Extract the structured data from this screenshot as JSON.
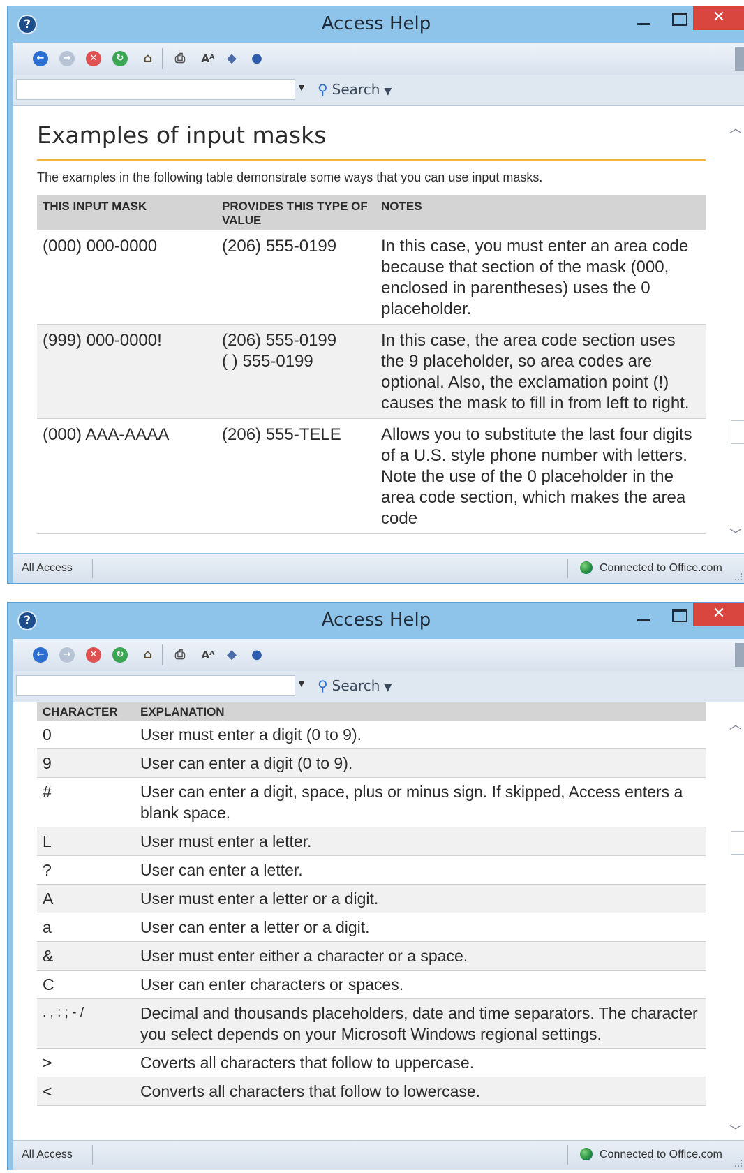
{
  "window": {
    "title": "Access Help",
    "close_glyph": "✕",
    "help_glyph": "?"
  },
  "toolbar": {
    "icons": [
      "back-icon",
      "forward-icon",
      "stop-icon",
      "refresh-icon",
      "home-icon",
      "print-icon",
      "font-size-icon",
      "toc-icon",
      "pin-icon"
    ]
  },
  "search": {
    "value": "",
    "button_label": "Search"
  },
  "status": {
    "left": "All Access",
    "right": "Connected to Office.com"
  },
  "page1": {
    "title": "Examples of input masks",
    "intro": "The examples in the following table demonstrate some ways that you can use input masks.",
    "headers": [
      "THIS INPUT MASK",
      "PROVIDES THIS TYPE OF VALUE",
      "NOTES"
    ],
    "rows": [
      {
        "mask": "(000) 000-0000",
        "value": "(206) 555-0199",
        "notes": "In this case, you must enter an area code because that section of the mask (000, enclosed in parentheses) uses the 0 placeholder."
      },
      {
        "mask": "(999) 000-0000!",
        "value": "(206) 555-0199\n( ) 555-0199",
        "notes": "In this case, the area code section uses the 9 placeholder, so area codes are optional. Also, the exclamation point (!) causes the mask to fill in from left to right."
      },
      {
        "mask": "(000) AAA-AAAA",
        "value": "(206) 555-TELE",
        "notes": "Allows you to substitute the last four digits of a U.S. style phone number with letters. Note the use of the 0 placeholder in the area code section, which makes the area code"
      }
    ]
  },
  "page2": {
    "headers": [
      "CHARACTER",
      "EXPLANATION"
    ],
    "rows": [
      {
        "char": "0",
        "explanation": "User must enter a digit (0 to 9)."
      },
      {
        "char": "9",
        "explanation": "User can enter a digit (0 to 9)."
      },
      {
        "char": "#",
        "explanation": "User can enter a digit, space, plus or minus sign. If skipped, Access enters a blank space."
      },
      {
        "char": "L",
        "explanation": "User must enter a letter."
      },
      {
        "char": "?",
        "explanation": "User can enter a letter."
      },
      {
        "char": "A",
        "explanation": "User must enter a letter or a digit."
      },
      {
        "char": "a",
        "explanation": "User can enter a letter or a digit."
      },
      {
        "char": "&",
        "explanation": "User must enter either a character or a space."
      },
      {
        "char": "C",
        "explanation": "User can enter characters or spaces."
      },
      {
        "char": ". , : ; - /",
        "explanation": "Decimal and thousands placeholders, date and time separators. The character you select depends on your Microsoft Windows regional settings."
      },
      {
        "char": ">",
        "explanation": "Coverts all characters that follow to uppercase."
      },
      {
        "char": "<",
        "explanation": "Converts all characters that follow to lowercase."
      }
    ]
  }
}
